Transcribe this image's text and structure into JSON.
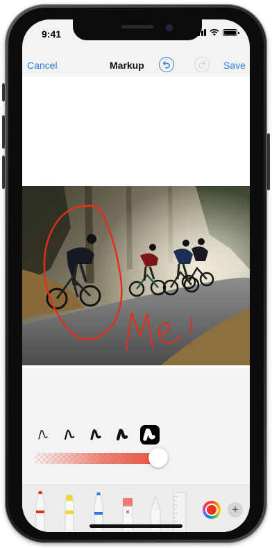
{
  "status_bar": {
    "time": "9:41"
  },
  "navbar": {
    "cancel_label": "Cancel",
    "title": "Markup",
    "save_label": "Save"
  },
  "photo": {
    "annotation_text": "Me!"
  },
  "stroke_options": [
    {
      "size": "thin"
    },
    {
      "size": "medium-thin"
    },
    {
      "size": "medium"
    },
    {
      "size": "thick"
    },
    {
      "size": "thickest",
      "selected": true
    }
  ],
  "opacity_slider": {
    "value": 0.95
  },
  "tools": [
    {
      "name": "pen-tool",
      "color": "#e8321e"
    },
    {
      "name": "highlighter-tool",
      "color": "#f3d23a"
    },
    {
      "name": "pencil-tool",
      "color": "#2c7ad6"
    },
    {
      "name": "eraser-tool",
      "color": "#f07a7a"
    },
    {
      "name": "lasso-tool",
      "color": "#cfcfcf"
    },
    {
      "name": "ruler-tool",
      "color": "#e3e3e3"
    }
  ],
  "colors": {
    "accent": "#2a7de1",
    "selected_ink": "#e8321e"
  }
}
